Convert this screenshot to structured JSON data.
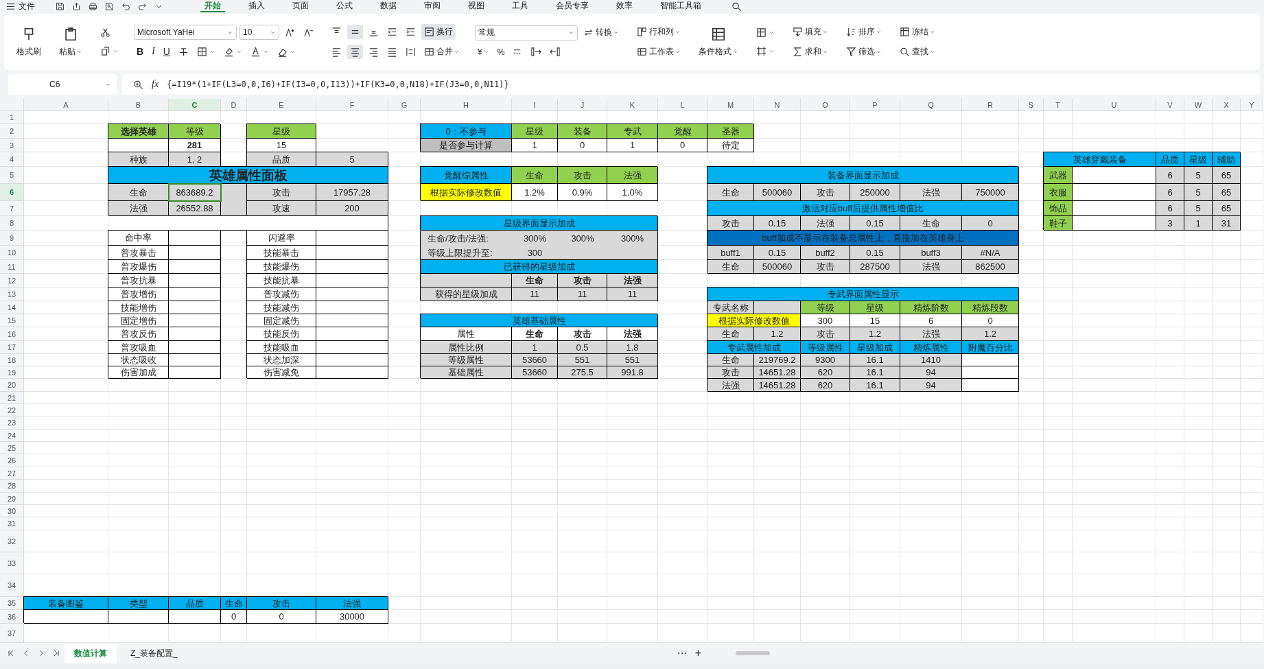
{
  "menu_bar": {
    "file": "文件",
    "tabs": [
      {
        "label": "开始",
        "selected": true
      },
      {
        "label": "插入",
        "selected": false
      },
      {
        "label": "页面",
        "selected": false
      },
      {
        "label": "公式",
        "selected": false
      },
      {
        "label": "数据",
        "selected": false
      },
      {
        "label": "审阅",
        "selected": false
      },
      {
        "label": "视图",
        "selected": false
      },
      {
        "label": "工具",
        "selected": false
      },
      {
        "label": "会员专享",
        "selected": false
      },
      {
        "label": "效率",
        "selected": false
      },
      {
        "label": "智能工具箱",
        "selected": false
      }
    ]
  },
  "ribbon": [
    {
      "kind": "big",
      "items": [
        {
          "label": "格式刷",
          "caret": false
        }
      ]
    },
    {
      "kind": "big",
      "items": [
        {
          "label": "粘贴",
          "caret": true
        }
      ]
    },
    {
      "kind": "stack",
      "upper": [
        {
          "caret": false
        }
      ],
      "lower": [
        {
          "caret": true
        }
      ]
    },
    {
      "kind": "stack",
      "upper": [
        {
          "kind": "field",
          "value": "Microsoft YaHei"
        },
        {
          "kind": "field",
          "value": "10"
        },
        {
          "caret": false
        },
        {
          "caret": false
        }
      ],
      "lower": [
        {
          "kind": "letter",
          "label": "B",
          "caret": false
        },
        {
          "kind": "letter",
          "label": "I",
          "caret": false
        },
        {
          "kind": "letter",
          "label": "U",
          "caret": false
        },
        {
          "caret": false
        },
        {
          "caret": true
        },
        {
          "caret": true
        },
        {
          "caret": true
        },
        {
          "caret": true
        }
      ]
    },
    {
      "kind": "stack",
      "upper": [
        {
          "caret": false,
          "selected": false
        },
        {
          "caret": false,
          "selected": true
        },
        {
          "caret": false,
          "selected": false
        },
        {
          "caret": false,
          "selected": false
        },
        {
          "caret": false,
          "selected": false
        },
        {
          "label": "换行",
          "caret": false,
          "selected": true
        }
      ],
      "lower": [
        {
          "caret": false,
          "selected": false
        },
        {
          "caret": false,
          "selected": true
        },
        {
          "caret": false,
          "selected": false
        },
        {
          "caret": false,
          "selected": false
        },
        {
          "caret": false,
          "selected": false
        },
        {
          "label": "合并",
          "caret": true,
          "selected": false
        }
      ]
    },
    {
      "kind": "stack",
      "upper": [
        {
          "kind": "field",
          "value": "常规"
        },
        {
          "label": "转换",
          "caret": true
        }
      ],
      "lower": [
        {
          "label": "¥",
          "caret": true
        },
        {
          "label": "%",
          "caret": false
        },
        {
          "caret": false
        },
        {
          "caret": false
        },
        {
          "caret": false
        }
      ]
    },
    {
      "kind": "stack",
      "upper": [
        {
          "label": "行和列",
          "caret": true
        }
      ],
      "lower": [
        {
          "label": "工作表",
          "caret": true
        }
      ]
    },
    {
      "kind": "big",
      "items": [
        {
          "label": "条件格式",
          "caret": true
        }
      ]
    },
    {
      "kind": "stack",
      "upper": [
        {
          "caret": true
        }
      ],
      "lower": [
        {
          "caret": true
        }
      ]
    },
    {
      "kind": "stack",
      "upper": [
        {
          "label": "填充",
          "caret": true
        }
      ],
      "lower": [
        {
          "label": "求和",
          "caret": true
        }
      ]
    },
    {
      "kind": "stack",
      "upper": [
        {
          "label": "排序",
          "caret": true
        }
      ],
      "lower": [
        {
          "label": "筛选",
          "caret": true
        }
      ]
    },
    {
      "kind": "stack",
      "upper": [
        {
          "label": "冻结",
          "caret": true
        }
      ],
      "lower": [
        {
          "label": "查找",
          "caret": true
        }
      ]
    }
  ],
  "formula_bar": {
    "name_box": "C6",
    "fx": "fx",
    "formula": "{=I19*(1+IF(L3=0,0,I6)+IF(I3=0,0,I13))+IF(K3=0,0,N18)+IF(J3=0,0,N11)}"
  },
  "sheet": {
    "columns": [
      {
        "label": "A",
        "selected": false
      },
      {
        "label": "B",
        "selected": false
      },
      {
        "label": "C",
        "selected": true
      },
      {
        "label": "D",
        "selected": false
      },
      {
        "label": "E",
        "selected": false
      },
      {
        "label": "F",
        "selected": false
      },
      {
        "label": "G",
        "selected": false
      },
      {
        "label": "H",
        "selected": false
      },
      {
        "label": "I",
        "selected": false
      },
      {
        "label": "J",
        "selected": false
      },
      {
        "label": "K",
        "selected": false
      },
      {
        "label": "L",
        "selected": false
      },
      {
        "label": "M",
        "selected": false
      },
      {
        "label": "N",
        "selected": false
      },
      {
        "label": "O",
        "selected": false
      },
      {
        "label": "P",
        "selected": false
      },
      {
        "label": "Q",
        "selected": false
      },
      {
        "label": "R",
        "selected": false
      },
      {
        "label": "S",
        "selected": false
      },
      {
        "label": "T",
        "selected": false
      },
      {
        "label": "U",
        "selected": false
      },
      {
        "label": "V",
        "selected": false
      },
      {
        "label": "W",
        "selected": false
      },
      {
        "label": "X",
        "selected": false
      },
      {
        "label": "Y",
        "selected": false
      }
    ],
    "rows": [
      {
        "label": "1",
        "selected": false
      },
      {
        "label": "2",
        "selected": false
      },
      {
        "label": "3",
        "selected": false
      },
      {
        "label": "4",
        "selected": false
      },
      {
        "label": "5",
        "selected": false
      },
      {
        "label": "6",
        "selected": true
      },
      {
        "label": "7",
        "selected": false
      },
      {
        "label": "8",
        "selected": false
      },
      {
        "label": "9",
        "selected": false
      },
      {
        "label": "10",
        "selected": false
      },
      {
        "label": "11",
        "selected": false
      },
      {
        "label": "12",
        "selected": false
      },
      {
        "label": "13",
        "selected": false
      },
      {
        "label": "14",
        "selected": false
      },
      {
        "label": "15",
        "selected": false
      },
      {
        "label": "16",
        "selected": false
      },
      {
        "label": "17",
        "selected": false
      },
      {
        "label": "18",
        "selected": false
      },
      {
        "label": "19",
        "selected": false
      },
      {
        "label": "20",
        "selected": false
      },
      {
        "label": "21",
        "selected": false
      },
      {
        "label": "22",
        "selected": false
      },
      {
        "label": "23",
        "selected": false
      },
      {
        "label": "24",
        "selected": false
      },
      {
        "label": "25",
        "selected": false
      },
      {
        "label": "26",
        "selected": false
      },
      {
        "label": "27",
        "selected": false
      },
      {
        "label": "28",
        "selected": false
      },
      {
        "label": "29",
        "selected": false
      },
      {
        "label": "30",
        "selected": false
      },
      {
        "label": "31",
        "selected": false
      },
      {
        "label": "32",
        "selected": false
      },
      {
        "label": "33",
        "selected": false
      },
      {
        "label": "34",
        "selected": false
      },
      {
        "label": "35",
        "selected": false
      },
      {
        "label": "36",
        "selected": false
      },
      {
        "label": "37",
        "selected": false
      }
    ],
    "tables": [
      {
        "rows": [
          [
            {
              "text": "选择英雄",
              "kind": "green",
              "bold": true
            },
            {
              "text": "等级",
              "kind": "green"
            },
            {
              "kind": "gap"
            },
            {
              "text": "星级",
              "kind": "green"
            }
          ],
          [
            {
              "kind": "white"
            },
            {
              "text": "281",
              "kind": "white",
              "bold": true
            },
            {
              "kind": "gap"
            },
            {
              "text": "15",
              "kind": "white"
            }
          ],
          [
            {
              "text": "种族",
              "kind": "gray"
            },
            {
              "text": "1, 2",
              "kind": "gray"
            },
            {
              "kind": "gap"
            },
            {
              "text": "品质",
              "kind": "gray"
            },
            {
              "text": "5",
              "kind": "gray"
            }
          ]
        ]
      },
      {
        "title": {
          "text": "英雄属性面板",
          "kind": "banner"
        },
        "rows": [
          [
            {
              "text": "生命",
              "kind": "gray"
            },
            {
              "text": "863689.2",
              "kind": "gray"
            },
            {
              "kind": "graygap"
            },
            {
              "text": "攻击",
              "kind": "gray"
            },
            {
              "text": "17957.28",
              "kind": "gray"
            }
          ],
          [
            {
              "text": "法强",
              "kind": "gray"
            },
            {
              "text": "26552.88",
              "kind": "gray"
            },
            {
              "kind": "graygap"
            },
            {
              "text": "攻速",
              "kind": "gray"
            },
            {
              "text": "200",
              "kind": "gray"
            }
          ],
          [
            {
              "kind": "blank"
            },
            {
              "kind": "blank"
            },
            {
              "kind": "blank"
            },
            {
              "kind": "blank"
            },
            {
              "kind": "blankend"
            }
          ],
          [
            {
              "text": "命中率",
              "kind": "white"
            },
            {
              "kind": "white"
            },
            {
              "kind": "gap"
            },
            {
              "text": "闪避率",
              "kind": "white"
            },
            {
              "kind": "white"
            }
          ],
          [
            {
              "text": "普攻暴击",
              "kind": "white"
            },
            {
              "kind": "white"
            },
            {
              "kind": "gap"
            },
            {
              "text": "技能暴击",
              "kind": "white"
            },
            {
              "kind": "white"
            }
          ],
          [
            {
              "text": "普攻爆伤",
              "kind": "white"
            },
            {
              "kind": "white"
            },
            {
              "kind": "gap"
            },
            {
              "text": "技能爆伤",
              "kind": "white"
            },
            {
              "kind": "white"
            }
          ],
          [
            {
              "text": "普攻抗暴",
              "kind": "white"
            },
            {
              "kind": "white"
            },
            {
              "kind": "gap"
            },
            {
              "text": "技能抗暴",
              "kind": "white"
            },
            {
              "kind": "white"
            }
          ],
          [
            {
              "text": "普攻增伤",
              "kind": "white"
            },
            {
              "kind": "white"
            },
            {
              "kind": "gap"
            },
            {
              "text": "普攻减伤",
              "kind": "white"
            },
            {
              "kind": "white"
            }
          ],
          [
            {
              "text": "技能增伤",
              "kind": "white"
            },
            {
              "kind": "white"
            },
            {
              "kind": "gap"
            },
            {
              "text": "技能减伤",
              "kind": "white"
            },
            {
              "kind": "white"
            }
          ],
          [
            {
              "text": "固定增伤",
              "kind": "white"
            },
            {
              "kind": "white"
            },
            {
              "kind": "gap"
            },
            {
              "text": "固定减伤",
              "kind": "white"
            },
            {
              "kind": "white"
            }
          ],
          [
            {
              "text": "普攻反伤",
              "kind": "white"
            },
            {
              "kind": "white"
            },
            {
              "kind": "gap"
            },
            {
              "text": "技能反伤",
              "kind": "white"
            },
            {
              "kind": "white"
            }
          ],
          [
            {
              "text": "普攻吸血",
              "kind": "white"
            },
            {
              "kind": "white"
            },
            {
              "kind": "gap"
            },
            {
              "text": "技能吸血",
              "kind": "white"
            },
            {
              "kind": "white"
            }
          ],
          [
            {
              "text": "状态吸收",
              "kind": "white"
            },
            {
              "kind": "white"
            },
            {
              "kind": "gap"
            },
            {
              "text": "状态加深",
              "kind": "white"
            },
            {
              "kind": "white"
            }
          ],
          [
            {
              "text": "伤害加成",
              "kind": "white"
            },
            {
              "kind": "white"
            },
            {
              "kind": "gap"
            },
            {
              "text": "伤害减免",
              "kind": "white"
            },
            {
              "kind": "white"
            }
          ]
        ]
      },
      {
        "rows": [
          [
            {
              "text": "0：不参与",
              "kind": "blue"
            },
            {
              "text": "星级",
              "kind": "green"
            },
            {
              "text": "装备",
              "kind": "green"
            },
            {
              "text": "专武",
              "kind": "green"
            },
            {
              "text": "觉醒",
              "kind": "green"
            },
            {
              "text": "圣器",
              "kind": "green"
            }
          ],
          [
            {
              "text": "是否参与计算",
              "kind": "silver"
            },
            {
              "text": "1",
              "kind": "white"
            },
            {
              "text": "0",
              "kind": "white"
            },
            {
              "text": "1",
              "kind": "white"
            },
            {
              "text": "0",
              "kind": "white"
            },
            {
              "text": "待定",
              "kind": "white"
            }
          ]
        ]
      },
      {
        "rows": [
          [
            {
              "text": "觉醒综属性",
              "kind": "blue"
            },
            {
              "text": "生命",
              "kind": "green"
            },
            {
              "text": "攻击",
              "kind": "green"
            },
            {
              "text": "法强",
              "kind": "green"
            }
          ],
          [
            {
              "text": "根据实际修改数值",
              "kind": "yellow"
            },
            {
              "text": "1.2%",
              "kind": "white"
            },
            {
              "text": "0.9%",
              "kind": "white"
            },
            {
              "text": "1.0%",
              "kind": "white"
            }
          ]
        ]
      },
      {
        "title": {
          "text": "星级界面显示加成",
          "kind": "blue"
        },
        "rows": [
          [
            {
              "text": "生命/攻击/法强:",
              "kind": "softlabel"
            },
            {
              "text": "300%",
              "kind": "soft"
            },
            {
              "text": "300%",
              "kind": "soft"
            },
            {
              "text": "300%",
              "kind": "softend"
            }
          ],
          [
            {
              "text": "等级上限提升至:",
              "kind": "softlabel"
            },
            {
              "text": "300",
              "kind": "soft"
            },
            {
              "kind": "soft"
            },
            {
              "kind": "softend"
            }
          ]
        ]
      },
      {
        "title": {
          "text": "已获得的星级加成",
          "kind": "blue"
        },
        "rows": [
          [
            {
              "kind": "gray"
            },
            {
              "text": "生命",
              "kind": "gray",
              "bold": true
            },
            {
              "text": "攻击",
              "kind": "gray",
              "bold": true
            },
            {
              "text": "法强",
              "kind": "gray",
              "bold": true
            }
          ],
          [
            {
              "text": "获得的星级加成",
              "kind": "gray"
            },
            {
              "text": "11",
              "kind": "gray"
            },
            {
              "text": "11",
              "kind": "gray"
            },
            {
              "text": "11",
              "kind": "gray"
            }
          ]
        ]
      },
      {
        "title": {
          "text": "英雄基础属性",
          "kind": "blue"
        },
        "rows": [
          [
            {
              "text": "属性",
              "kind": "white"
            },
            {
              "text": "生命",
              "kind": "white",
              "bold": true
            },
            {
              "text": "攻击",
              "kind": "white",
              "bold": true
            },
            {
              "text": "法强",
              "kind": "white",
              "bold": true
            }
          ],
          [
            {
              "text": "属性比例",
              "kind": "gray"
            },
            {
              "text": "1",
              "kind": "gray"
            },
            {
              "text": "0.5",
              "kind": "gray"
            },
            {
              "text": "1.8",
              "kind": "gray"
            }
          ],
          [
            {
              "text": "等级属性",
              "kind": "gray"
            },
            {
              "text": "53660",
              "kind": "gray"
            },
            {
              "text": "551",
              "kind": "gray"
            },
            {
              "text": "551",
              "kind": "gray"
            }
          ],
          [
            {
              "text": "基础属性",
              "kind": "gray"
            },
            {
              "text": "53660",
              "kind": "gray"
            },
            {
              "text": "275.5",
              "kind": "gray"
            },
            {
              "text": "991.8",
              "kind": "gray"
            }
          ]
        ]
      },
      {
        "title": {
          "text": "装备界面显示加成",
          "kind": "blue"
        },
        "rows": [
          [
            {
              "text": "生命",
              "kind": "gray"
            },
            {
              "text": "500060",
              "kind": "gray"
            },
            {
              "text": "攻击",
              "kind": "gray"
            },
            {
              "text": "250000",
              "kind": "gray"
            },
            {
              "text": "法强",
              "kind": "gray"
            },
            {
              "text": "750000",
              "kind": "gray"
            }
          ]
        ]
      },
      {
        "title": {
          "text": "激活对应buff后提供属性增值比",
          "kind": "blue"
        },
        "rows": [
          [
            {
              "text": "攻击",
              "kind": "gray"
            },
            {
              "text": "0.15",
              "kind": "gray"
            },
            {
              "text": "法强",
              "kind": "gray"
            },
            {
              "text": "0.15",
              "kind": "gray"
            },
            {
              "text": "生命",
              "kind": "gray"
            },
            {
              "text": "0",
              "kind": "gray"
            }
          ]
        ]
      },
      {
        "title": {
          "text": "buff加成不显示在装备总属性上，直接加在英雄身上",
          "kind": "navy"
        },
        "rows": [
          [
            {
              "text": "buff1",
              "kind": "gray"
            },
            {
              "text": "0.15",
              "kind": "gray"
            },
            {
              "text": "buff2",
              "kind": "gray"
            },
            {
              "text": "0.15",
              "kind": "gray"
            },
            {
              "text": "buff3",
              "kind": "gray"
            },
            {
              "text": "#N/A",
              "kind": "gray"
            }
          ],
          [
            {
              "text": "生命",
              "kind": "gray"
            },
            {
              "text": "500060",
              "kind": "gray"
            },
            {
              "text": "攻击",
              "kind": "gray"
            },
            {
              "text": "287500",
              "kind": "gray"
            },
            {
              "text": "法强",
              "kind": "gray"
            },
            {
              "text": "862500",
              "kind": "gray"
            }
          ]
        ]
      },
      {
        "title": {
          "text": "专武界面属性显示",
          "kind": "blue"
        },
        "rows": [
          [
            {
              "text": "专武名称",
              "kind": "gray"
            },
            {
              "kind": "gray"
            },
            {
              "text": "等级",
              "kind": "green"
            },
            {
              "text": "星级",
              "kind": "green"
            },
            {
              "text": "精炼阶数",
              "kind": "green"
            },
            {
              "text": "精炼段数",
              "kind": "green"
            }
          ],
          [
            {
              "text": "根据实际修改数值",
              "kind": "yellow"
            },
            {
              "kind": "covered"
            },
            {
              "text": "300",
              "kind": "white"
            },
            {
              "text": "15",
              "kind": "white"
            },
            {
              "text": "6",
              "kind": "white"
            },
            {
              "text": "0",
              "kind": "white"
            }
          ],
          [
            {
              "text": "生命",
              "kind": "gray"
            },
            {
              "text": "1.2",
              "kind": "gray"
            },
            {
              "text": "攻击",
              "kind": "gray"
            },
            {
              "text": "1.2",
              "kind": "gray"
            },
            {
              "text": "法强",
              "kind": "gray"
            },
            {
              "text": "1.2",
              "kind": "gray"
            }
          ],
          [
            {
              "text": "专武属性加成",
              "kind": "blue"
            },
            {
              "kind": "covered"
            },
            {
              "text": "等级属性",
              "kind": "blue"
            },
            {
              "text": "星级加成",
              "kind": "blue"
            },
            {
              "text": "精炼属性",
              "kind": "blue"
            },
            {
              "text": "附魔百分比",
              "kind": "blue"
            }
          ],
          [
            {
              "text": "生命",
              "kind": "gray"
            },
            {
              "text": "219769.2",
              "kind": "gray"
            },
            {
              "text": "9300",
              "kind": "gray"
            },
            {
              "text": "16.1",
              "kind": "gray"
            },
            {
              "text": "1410",
              "kind": "gray"
            },
            {
              "kind": "white"
            }
          ],
          [
            {
              "text": "攻击",
              "kind": "gray"
            },
            {
              "text": "14651.28",
              "kind": "gray"
            },
            {
              "text": "620",
              "kind": "gray"
            },
            {
              "text": "16.1",
              "kind": "gray"
            },
            {
              "text": "94",
              "kind": "gray"
            },
            {
              "kind": "white"
            }
          ],
          [
            {
              "text": "法强",
              "kind": "gray"
            },
            {
              "text": "14651.28",
              "kind": "gray"
            },
            {
              "text": "620",
              "kind": "gray"
            },
            {
              "text": "16.1",
              "kind": "gray"
            },
            {
              "text": "94",
              "kind": "gray"
            },
            {
              "kind": "white"
            }
          ]
        ]
      },
      {
        "rows": [
          [
            {
              "text": "英雄穿戴装备",
              "kind": "blue"
            },
            {
              "kind": "covered"
            },
            {
              "text": "品质",
              "kind": "blue"
            },
            {
              "text": "星级",
              "kind": "blue"
            },
            {
              "text": "辅助",
              "kind": "blue"
            }
          ],
          [
            {
              "text": "武器",
              "kind": "green"
            },
            {
              "kind": "white"
            },
            {
              "text": "6",
              "kind": "gray"
            },
            {
              "text": "5",
              "kind": "gray"
            },
            {
              "text": "65",
              "kind": "gray"
            }
          ],
          [
            {
              "text": "衣服",
              "kind": "green"
            },
            {
              "kind": "white"
            },
            {
              "text": "6",
              "kind": "gray"
            },
            {
              "text": "5",
              "kind": "gray"
            },
            {
              "text": "65",
              "kind": "gray"
            }
          ],
          [
            {
              "text": "饰品",
              "kind": "green"
            },
            {
              "kind": "white"
            },
            {
              "text": "6",
              "kind": "gray"
            },
            {
              "text": "5",
              "kind": "gray"
            },
            {
              "text": "65",
              "kind": "gray"
            }
          ],
          [
            {
              "text": "鞋子",
              "kind": "green"
            },
            {
              "kind": "white"
            },
            {
              "text": "3",
              "kind": "gray"
            },
            {
              "text": "1",
              "kind": "gray"
            },
            {
              "text": "31",
              "kind": "gray"
            }
          ]
        ]
      },
      {
        "rows": [
          [
            {
              "text": "装备图鉴",
              "kind": "blue"
            },
            {
              "text": "类型",
              "kind": "blue"
            },
            {
              "text": "品质",
              "kind": "blue"
            },
            {
              "text": "生命",
              "kind": "blue"
            },
            {
              "text": "攻击",
              "kind": "blue"
            },
            {
              "text": "法强",
              "kind": "blue"
            }
          ],
          [
            {
              "kind": "white"
            },
            {
              "kind": "white"
            },
            {
              "kind": "white"
            },
            {
              "text": "0",
              "kind": "white"
            },
            {
              "text": "0",
              "kind": "white"
            },
            {
              "text": "30000",
              "kind": "white"
            }
          ]
        ]
      }
    ]
  },
  "sheet_tabs": {
    "tabs": [
      {
        "label": "数值计算",
        "selected": true
      },
      {
        "label": "Z_装备配置_",
        "selected": false
      }
    ],
    "more": "⋯",
    "add": "+"
  }
}
